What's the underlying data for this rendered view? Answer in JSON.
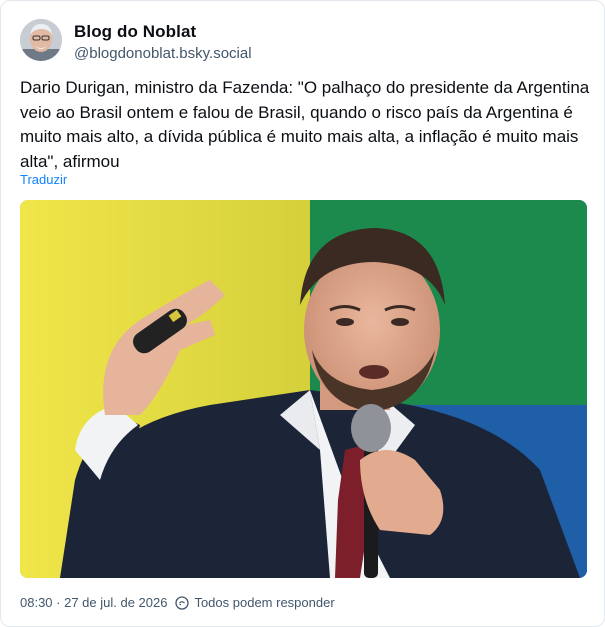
{
  "author": {
    "display_name": "Blog do Noblat",
    "handle": "@blogdonoblat.bsky.social",
    "avatar_icon": "avatar-photo"
  },
  "post": {
    "text": "Dario Durigan, ministro da Fazenda: \"O palhaço do presidente da Argentina veio ao Brasil ontem e falou de Brasil, quando o risco país da Argentina é muito mais alto, a dívida pública é muito mais alta, a inflação é muito mais alta\", afirmou",
    "translate_label": "Traduzir",
    "image_icon": "photo-man-with-microphone"
  },
  "footer": {
    "timestamp": "08:30 · 27 de jul. de 2026",
    "reply_setting": "Todos podem responder",
    "reply_icon": "globe-chat-icon"
  },
  "colors": {
    "link": "#1083fe",
    "muted": "#42576c",
    "border": "#e3e8ee"
  }
}
